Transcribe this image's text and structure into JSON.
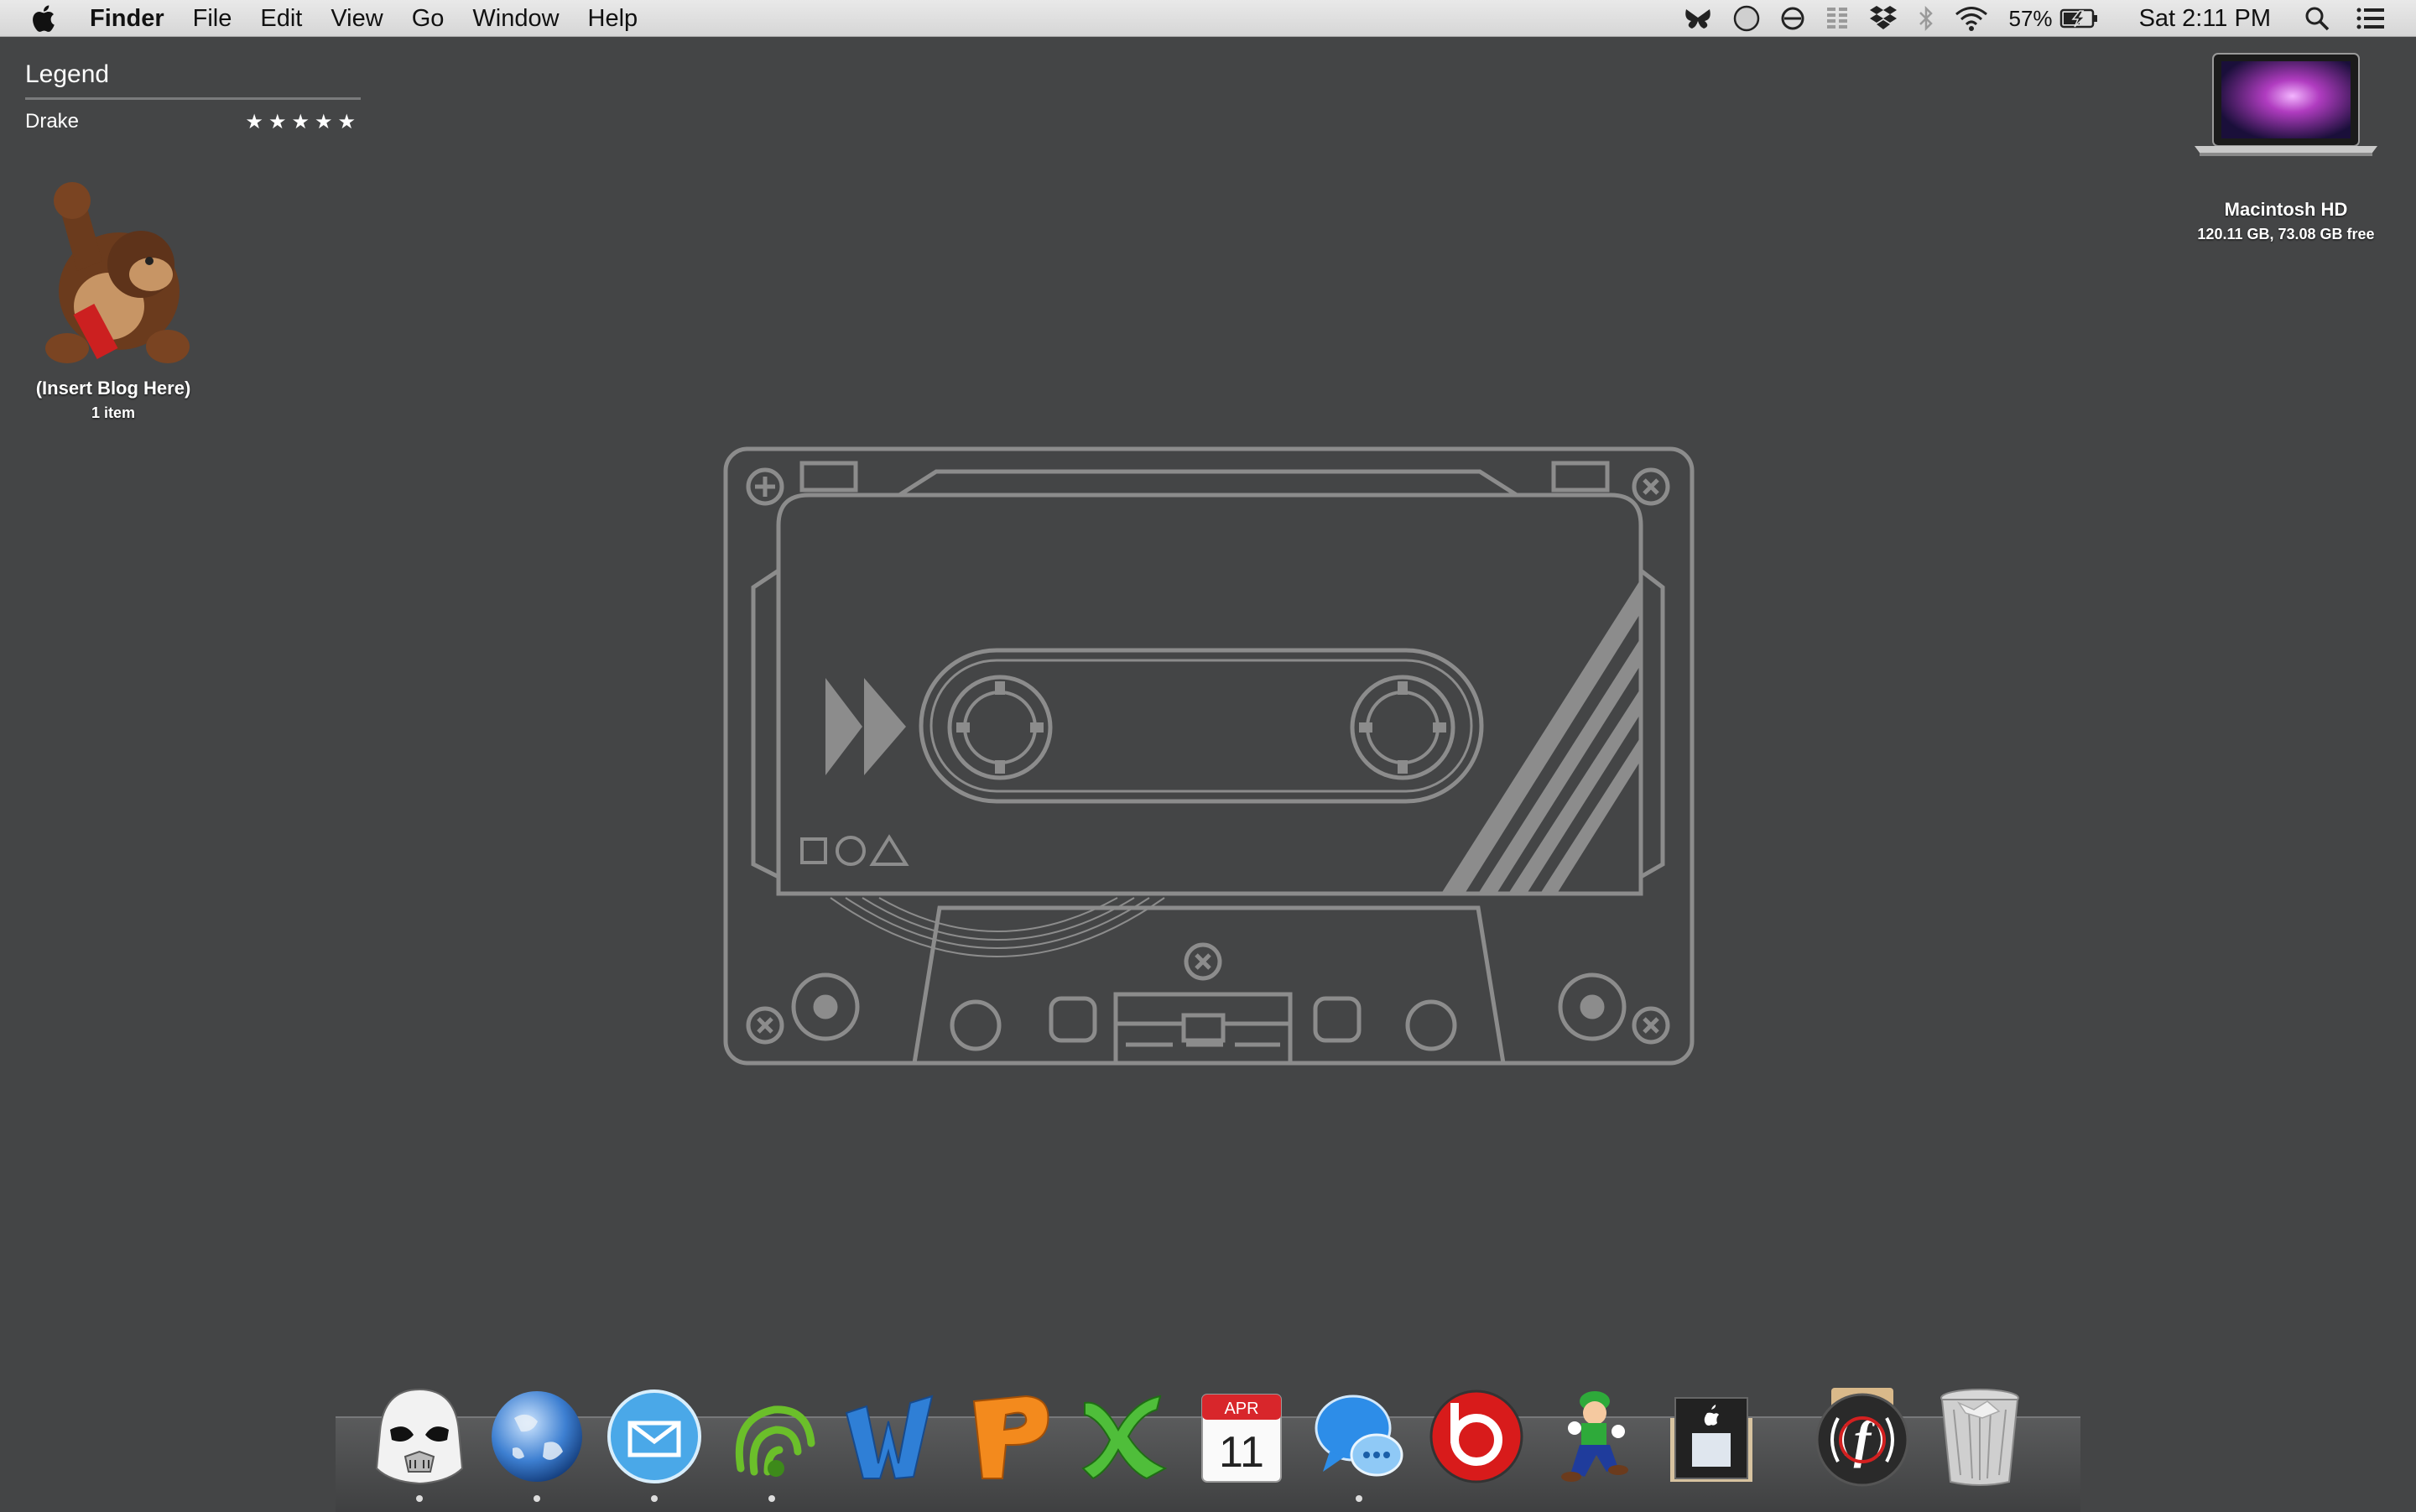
{
  "menubar": {
    "apple_icon": "apple-icon",
    "items": [
      "Finder",
      "File",
      "Edit",
      "View",
      "Go",
      "Window",
      "Help"
    ],
    "status": {
      "battery_percent": "57%",
      "clock": "Sat 2:11 PM",
      "icons": [
        "butterfly-icon",
        "record-circle-icon",
        "do-not-disturb-icon",
        "columns-icon",
        "dropbox-icon",
        "bluetooth-icon",
        "wifi-icon",
        "battery-charging-icon",
        "spotlight-search-icon",
        "notification-center-icon"
      ]
    }
  },
  "widget": {
    "title": "Legend",
    "row_label": "Drake",
    "rating_stars": "★★★★★",
    "rating": 5
  },
  "desktop": {
    "folder": {
      "label": "(Insert Blog Here)",
      "subtitle": "1 item",
      "icon": "donkey-kong-icon"
    },
    "drive": {
      "label": "Macintosh HD",
      "subtitle": "120.11 GB, 73.08 GB free",
      "icon": "macbook-icon"
    }
  },
  "wallpaper": {
    "subject": "cassette-tape-outline",
    "line_color": "#8c8c8c"
  },
  "dock": {
    "items": [
      {
        "icon": "stormtrooper-helmet-icon",
        "running": true
      },
      {
        "icon": "globe-icon",
        "running": true
      },
      {
        "icon": "mailbox-app-icon",
        "running": true
      },
      {
        "icon": "green-swirl-app-icon",
        "running": true
      },
      {
        "icon": "word-icon",
        "running": false
      },
      {
        "icon": "powerpoint-icon",
        "running": false
      },
      {
        "icon": "excel-icon",
        "running": false
      },
      {
        "icon": "calendar-icon",
        "running": false,
        "month": "APR",
        "day": "11"
      },
      {
        "icon": "messages-icon",
        "running": true
      },
      {
        "icon": "beats-icon",
        "running": false
      },
      {
        "icon": "luigi-icon",
        "running": false
      },
      {
        "icon": "apple-store-icon",
        "running": false
      },
      {
        "icon": "fanatic-app-icon",
        "running": false
      },
      {
        "icon": "trash-icon",
        "running": false
      }
    ]
  }
}
